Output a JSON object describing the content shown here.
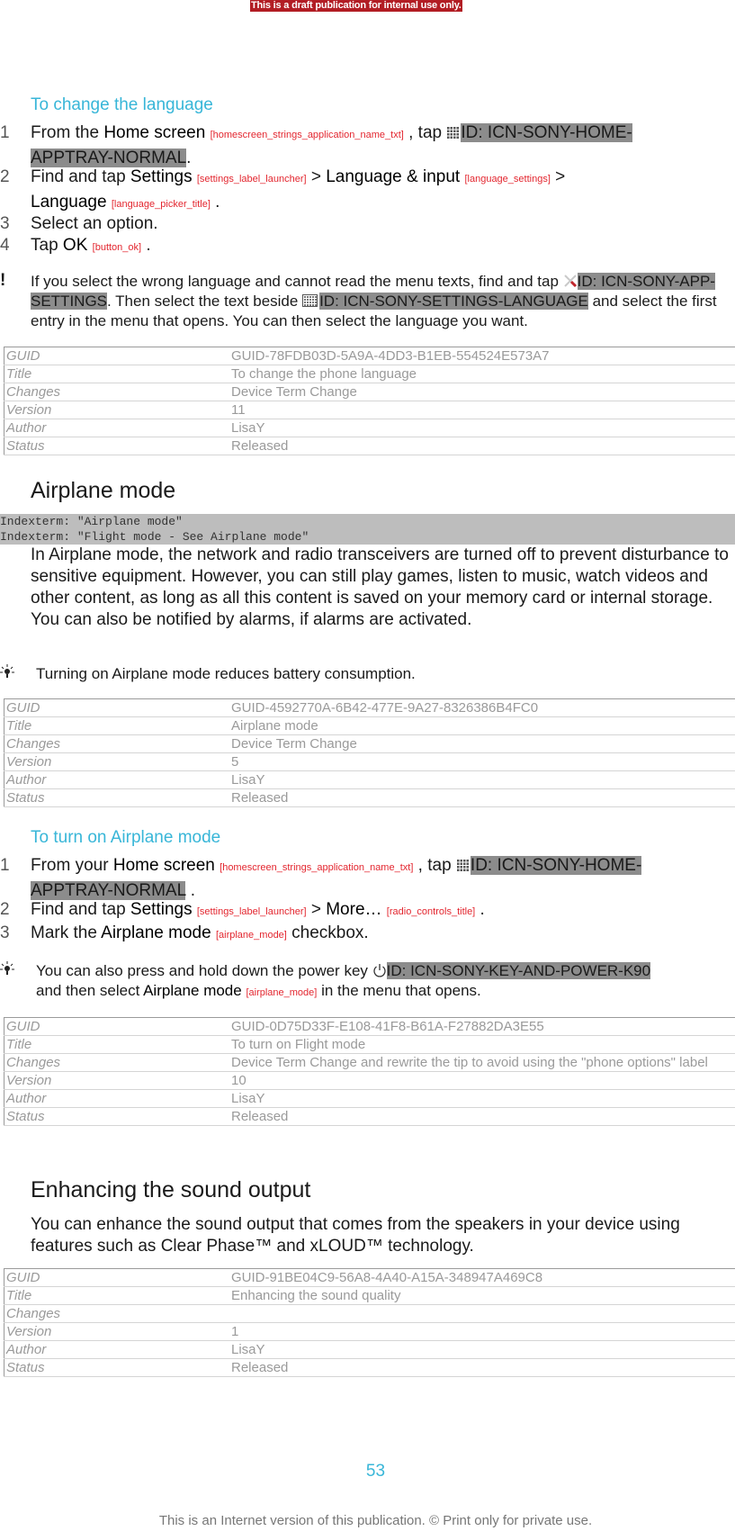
{
  "draft_banner": "This is a draft publication for internal use only.",
  "section1": {
    "title": "To change the language",
    "steps": [
      {
        "num": "1",
        "p1": "From the ",
        "ui1": "Home screen",
        "tag1": "[homescreen_strings_application_name_txt]",
        "p2": " , tap ",
        "icon_id": "ID: ICN-SONY-HOME-APPTRAY-NORMAL",
        "p3": "."
      },
      {
        "num": "2",
        "p1": "Find and tap ",
        "ui1": "Settings",
        "tag1": "[settings_label_launcher]",
        "p2": " > ",
        "ui2": "Language & input",
        "tag2": "[language_settings]",
        "p3": " > ",
        "ui3": "Language",
        "tag3": "[language_picker_title]",
        "p4": " ."
      },
      {
        "num": "3",
        "text": "Select an option."
      },
      {
        "num": "4",
        "p1": "Tap ",
        "ui1": "OK",
        "tag1": "[button_ok]",
        "p2": " ."
      }
    ],
    "warning": {
      "p1": "If you select the wrong language and cannot read the menu texts, find and tap ",
      "icon1_id": "ID: ICN-SONY-APP-SETTINGS",
      "p2": ". Then select the text beside ",
      "icon2_id": "ID: ICN-SONY-SETTINGS-LANGUAGE",
      "p3": " and select the first entry in the menu that opens. You can then select the language you want."
    },
    "meta": [
      {
        "k": "GUID",
        "v": "GUID-78FDB03D-5A9A-4DD3-B1EB-554524E573A7"
      },
      {
        "k": "Title",
        "v": "To change the phone language"
      },
      {
        "k": "Changes",
        "v": "Device Term Change"
      },
      {
        "k": "Version",
        "v": "11"
      },
      {
        "k": "Author",
        "v": "LisaY"
      },
      {
        "k": "Status",
        "v": "Released"
      }
    ]
  },
  "section2": {
    "title": "Airplane mode",
    "indexterms": [
      "Indexterm: \"Airplane mode\"",
      "Indexterm: \"Flight mode - See Airplane mode\""
    ],
    "body": "In Airplane mode, the network and radio transceivers are turned off to prevent disturbance to sensitive equipment. However, you can still play games, listen to music, watch videos and other content, as long as all this content is saved on your memory card or internal storage. You can also be notified by alarms, if alarms are activated.",
    "tip": "Turning on Airplane mode reduces battery consumption.",
    "meta": [
      {
        "k": "GUID",
        "v": "GUID-4592770A-6B42-477E-9A27-8326386B4FC0"
      },
      {
        "k": "Title",
        "v": "Airplane mode"
      },
      {
        "k": "Changes",
        "v": "Device Term Change"
      },
      {
        "k": "Version",
        "v": "5"
      },
      {
        "k": "Author",
        "v": "LisaY"
      },
      {
        "k": "Status",
        "v": "Released"
      }
    ]
  },
  "section3": {
    "title": "To turn on Airplane mode",
    "steps": [
      {
        "num": "1",
        "p1": "From your ",
        "ui1": "Home screen",
        "tag1": "[homescreen_strings_application_name_txt]",
        "p2": " , tap ",
        "icon_id": "ID: ICN-SONY-HOME-APPTRAY-NORMAL",
        "p3": " ."
      },
      {
        "num": "2",
        "p1": "Find and tap ",
        "ui1": "Settings",
        "tag1": "[settings_label_launcher]",
        "p2": " > ",
        "ui2": "More…",
        "tag2": "[radio_controls_title]",
        "p3": " ."
      },
      {
        "num": "3",
        "p1": "Mark the ",
        "ui1": "Airplane mode",
        "tag1": "[airplane_mode]",
        "p2": " checkbox."
      }
    ],
    "tip": {
      "p1": "You can also press and hold down the power key ",
      "icon_id": "ID: ICN-SONY-KEY-AND-POWER-K90",
      "p2": " and then select ",
      "ui1": "Airplane mode",
      "tag1": "[airplane_mode]",
      "p3": " in the menu that opens."
    },
    "meta": [
      {
        "k": "GUID",
        "v": "GUID-0D75D33F-E108-41F8-B61A-F27882DA3E55"
      },
      {
        "k": "Title",
        "v": "To turn on Flight mode"
      },
      {
        "k": "Changes",
        "v": "Device Term Change and rewrite the tip to avoid using the \"phone options\" label"
      },
      {
        "k": "Version",
        "v": "10"
      },
      {
        "k": "Author",
        "v": "LisaY"
      },
      {
        "k": "Status",
        "v": "Released"
      }
    ]
  },
  "section4": {
    "title": "Enhancing the sound output",
    "body": "You can enhance the sound output that comes from the speakers in your device using features such as Clear Phase™ and xLOUD™ technology.",
    "meta": [
      {
        "k": "GUID",
        "v": "GUID-91BE04C9-56A8-4A40-A15A-348947A469C8"
      },
      {
        "k": "Title",
        "v": "Enhancing the sound quality"
      },
      {
        "k": "Changes",
        "v": ""
      },
      {
        "k": "Version",
        "v": "1"
      },
      {
        "k": "Author",
        "v": "LisaY"
      },
      {
        "k": "Status",
        "v": "Released"
      }
    ]
  },
  "page_number": "53",
  "footer": "This is an Internet version of this publication. © Print only for private use."
}
